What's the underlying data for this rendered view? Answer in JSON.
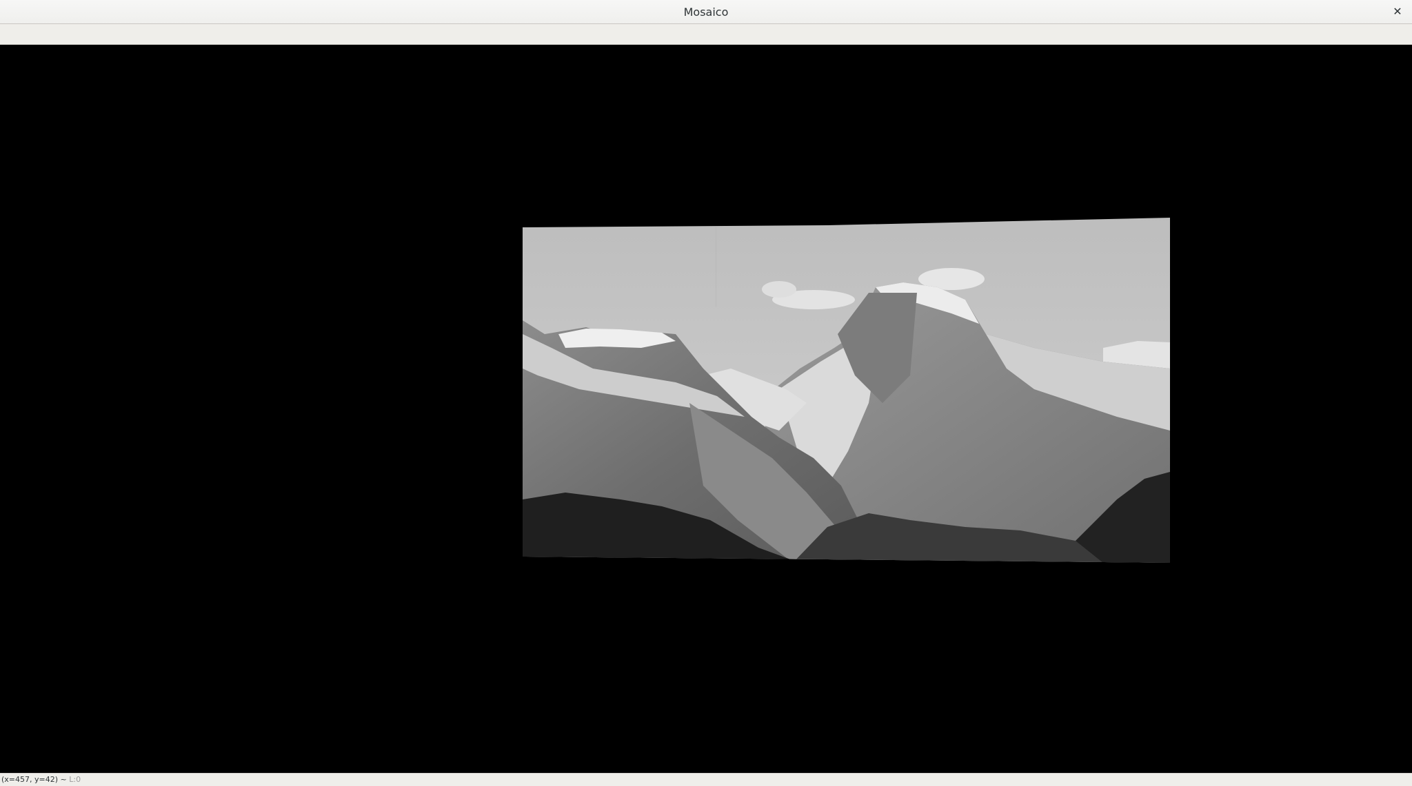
{
  "window": {
    "title": "Mosaico",
    "close_icon": "close-icon",
    "close_glyph": "✕"
  },
  "image_view": {
    "description_icon": "grayscale-panorama-image"
  },
  "statusbar": {
    "coords": "(x=457, y=42) ~",
    "level": "L:0"
  }
}
